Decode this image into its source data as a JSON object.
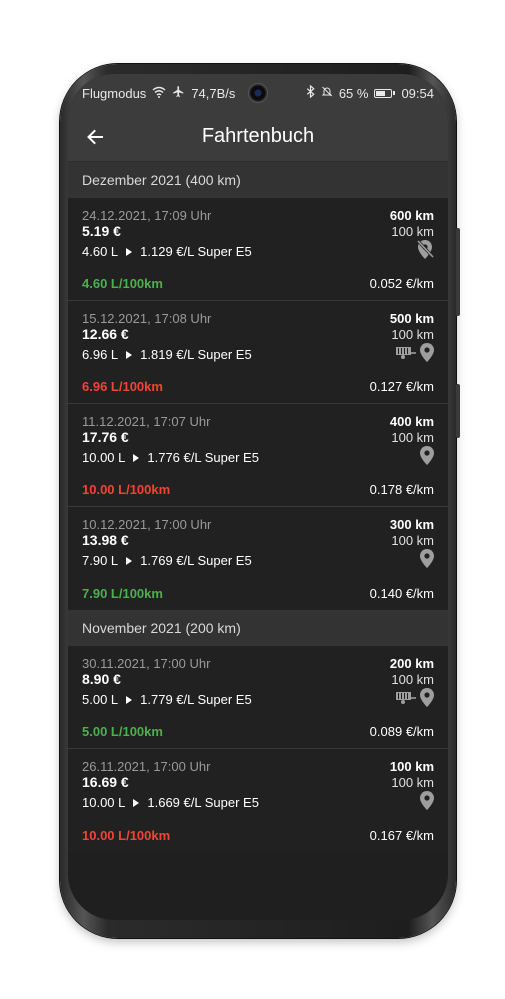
{
  "status_bar": {
    "airplane_mode_label": "Flugmodus",
    "network_speed": "74,7B/s",
    "battery_percent": "65 %",
    "battery_level": 0.65,
    "time": "09:54",
    "icons": [
      "wifi-icon",
      "airplane-icon",
      "bluetooth-icon",
      "mute-icon",
      "battery-icon"
    ]
  },
  "app_bar": {
    "title": "Fahrtenbuch",
    "back_icon": "arrow-left-icon"
  },
  "colors": {
    "background": "#1f1f1f",
    "header_bar": "#3c3c3c",
    "section_header": "#333333",
    "good": "#4caf50",
    "bad": "#f44336"
  },
  "groups": [
    {
      "title": "Dezember 2021 (400 km)",
      "entries": [
        {
          "date": "24.12.2021, 17:09 Uhr",
          "price": "5.19 €",
          "liters": "4.60 L",
          "price_per_liter": "1.129 €/L Super E5",
          "consumption": "4.60 L/100km",
          "consumption_status": "good",
          "odometer": "600 km",
          "distance": "100 km",
          "cost_per_km": "0.052 €/km",
          "icons": [
            "location-off-icon"
          ]
        },
        {
          "date": "15.12.2021, 17:08 Uhr",
          "price": "12.66 €",
          "liters": "6.96 L",
          "price_per_liter": "1.819 €/L Super E5",
          "consumption": "6.96 L/100km",
          "consumption_status": "bad",
          "odometer": "500 km",
          "distance": "100 km",
          "cost_per_km": "0.127 €/km",
          "icons": [
            "trailer-icon",
            "location-pin-icon"
          ]
        },
        {
          "date": "11.12.2021, 17:07 Uhr",
          "price": "17.76 €",
          "liters": "10.00 L",
          "price_per_liter": "1.776 €/L Super E5",
          "consumption": "10.00 L/100km",
          "consumption_status": "bad",
          "odometer": "400 km",
          "distance": "100 km",
          "cost_per_km": "0.178 €/km",
          "icons": [
            "location-pin-icon"
          ]
        },
        {
          "date": "10.12.2021, 17:00 Uhr",
          "price": "13.98 €",
          "liters": "7.90 L",
          "price_per_liter": "1.769 €/L Super E5",
          "consumption": "7.90 L/100km",
          "consumption_status": "good",
          "odometer": "300 km",
          "distance": "100 km",
          "cost_per_km": "0.140 €/km",
          "icons": [
            "location-pin-icon"
          ]
        }
      ]
    },
    {
      "title": "November 2021 (200 km)",
      "entries": [
        {
          "date": "30.11.2021, 17:00 Uhr",
          "price": "8.90 €",
          "liters": "5.00 L",
          "price_per_liter": "1.779 €/L Super E5",
          "consumption": "5.00 L/100km",
          "consumption_status": "good",
          "odometer": "200 km",
          "distance": "100 km",
          "cost_per_km": "0.089 €/km",
          "icons": [
            "trailer-icon",
            "location-pin-icon"
          ]
        },
        {
          "date": "26.11.2021, 17:00 Uhr",
          "price": "16.69 €",
          "liters": "10.00 L",
          "price_per_liter": "1.669 €/L Super E5",
          "consumption": "10.00 L/100km",
          "consumption_status": "bad",
          "odometer": "100 km",
          "distance": "100 km",
          "cost_per_km": "0.167 €/km",
          "icons": [
            "location-pin-icon"
          ]
        }
      ]
    }
  ]
}
